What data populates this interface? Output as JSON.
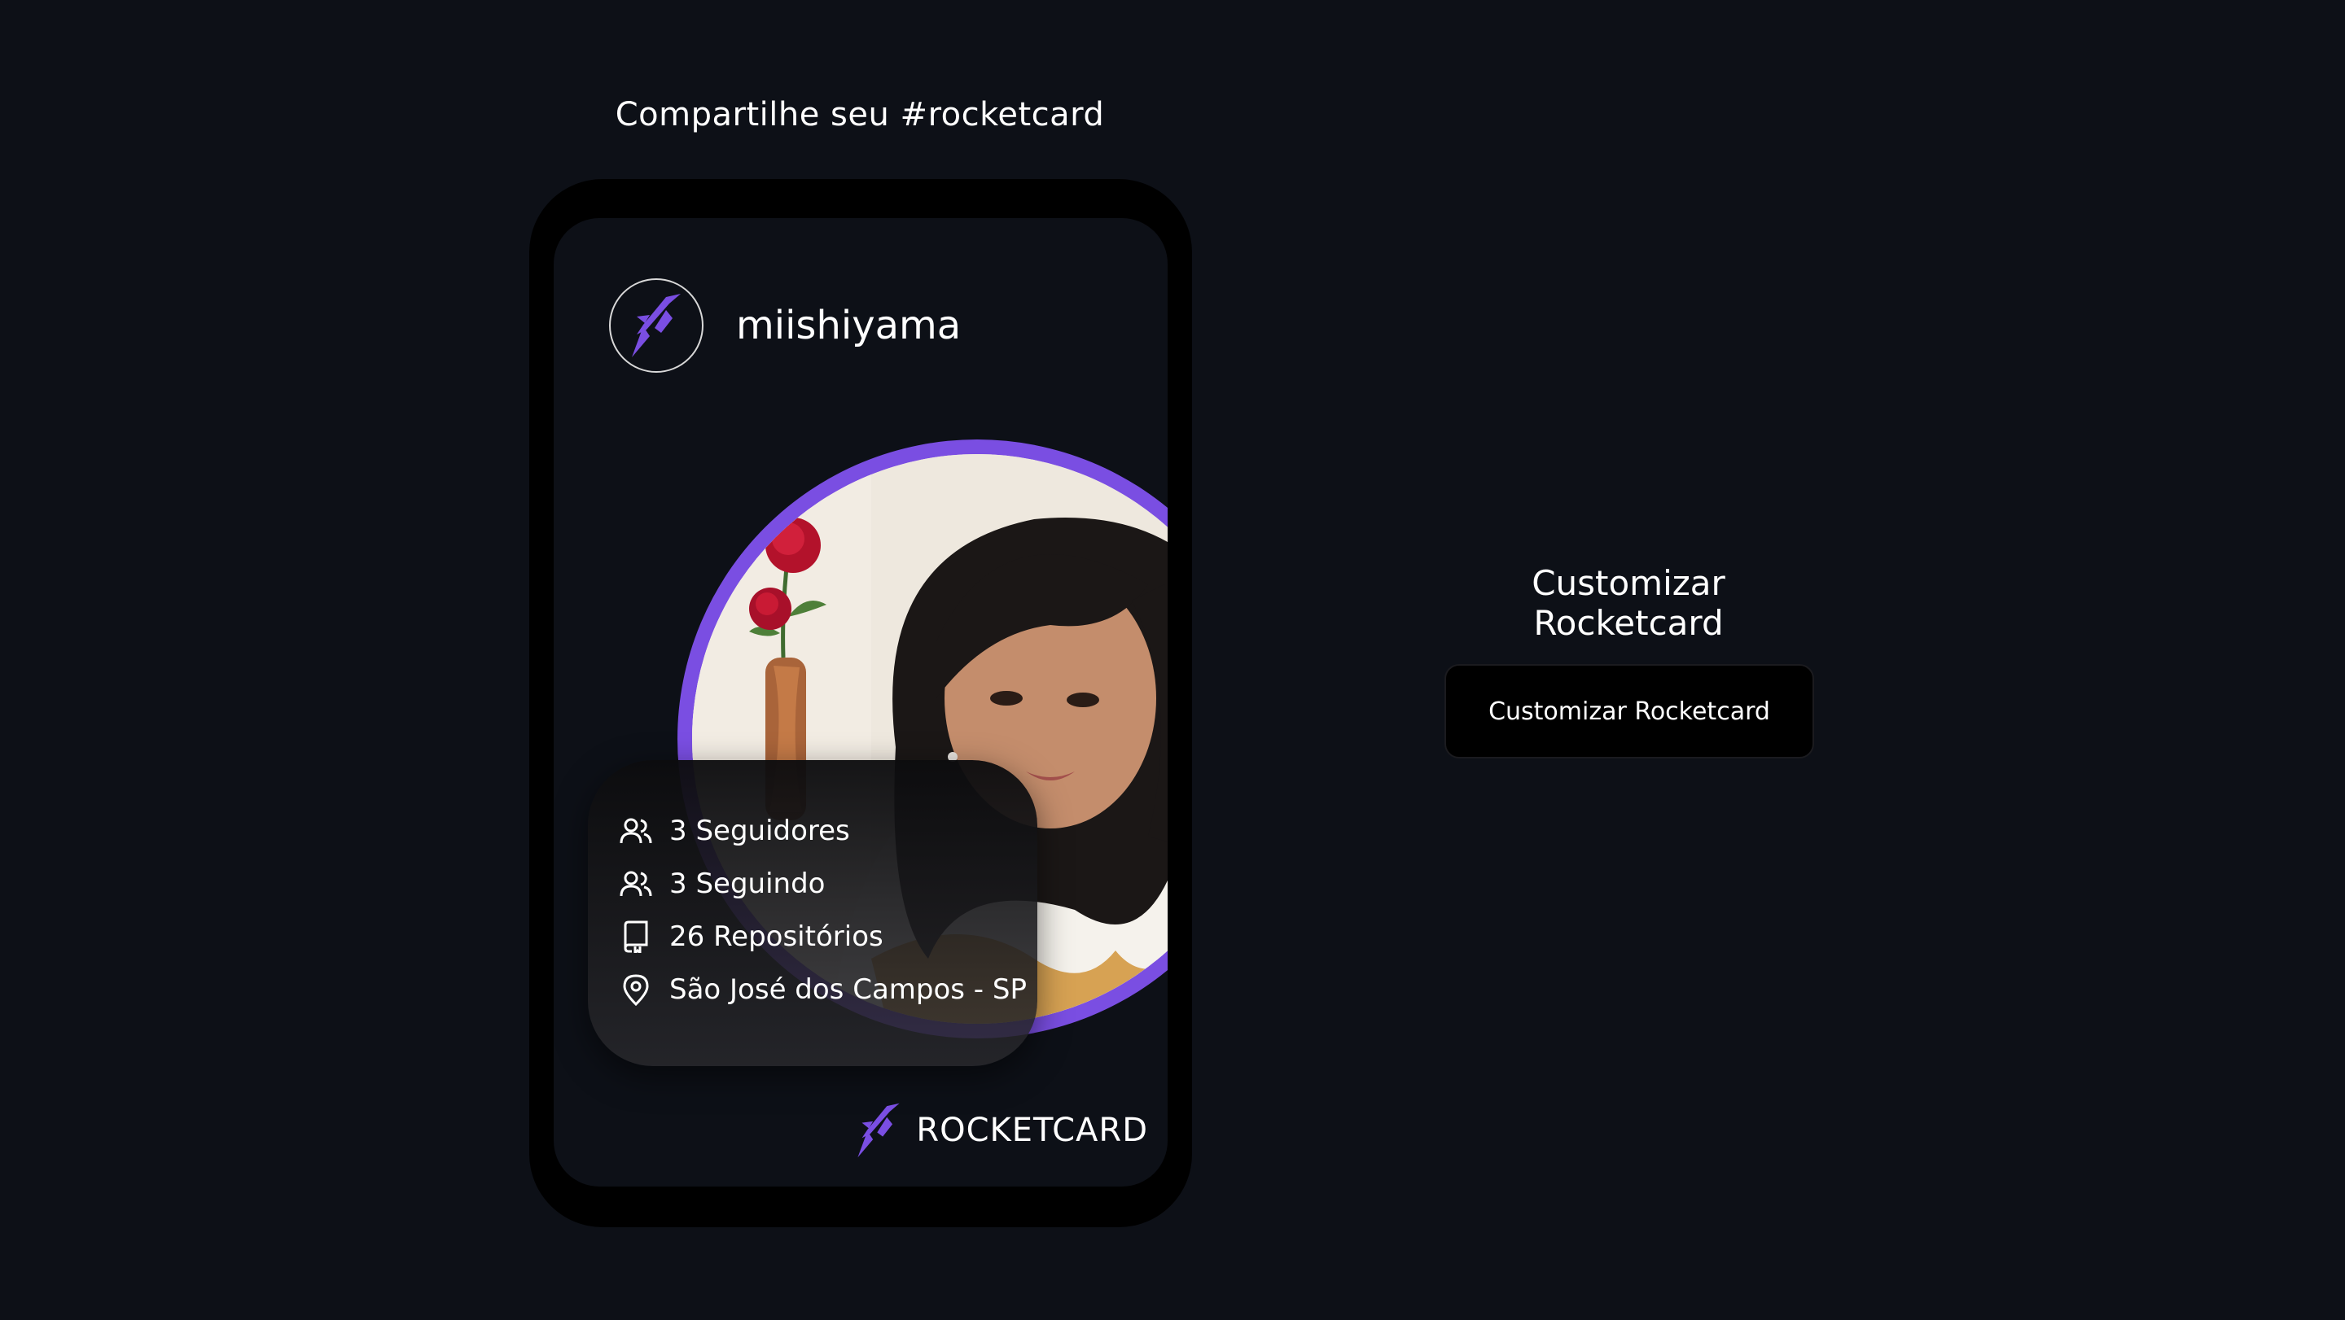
{
  "header": {
    "share_title": "Compartilhe seu #rocketcard"
  },
  "card": {
    "username": "miishiyama",
    "logo_icon": "rocket-icon",
    "accent_color": "#7a4ee2",
    "stats": [
      {
        "icon": "users-icon",
        "label": "3 Seguidores"
      },
      {
        "icon": "users-icon",
        "label": "3 Seguindo"
      },
      {
        "icon": "repo-icon",
        "label": "26 Repositórios"
      },
      {
        "icon": "location-pin-icon",
        "label": "São José dos Campos - SP"
      }
    ],
    "brand_name": "ROCKETCARD"
  },
  "customize": {
    "title": "Customizar Rocketcard",
    "button_label": "Customizar Rocketcard"
  }
}
